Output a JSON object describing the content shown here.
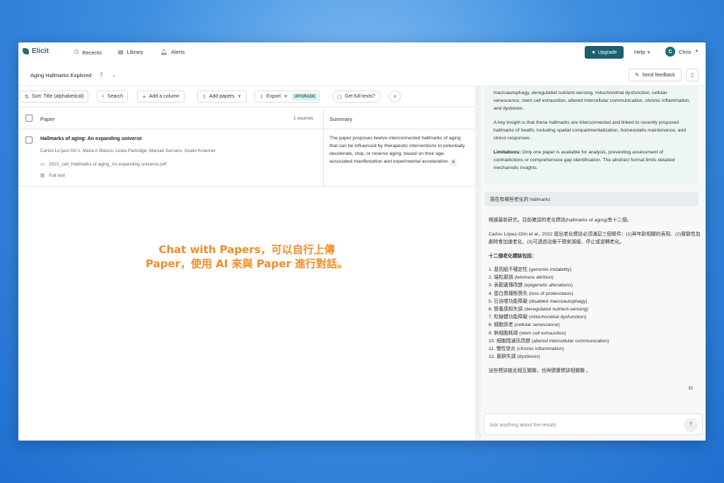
{
  "app": {
    "logo": "Elicit",
    "nav": [
      {
        "label": "Recents",
        "icon": "clock-icon"
      },
      {
        "label": "Library",
        "icon": "library-icon"
      },
      {
        "label": "Alerts",
        "icon": "bell-icon"
      }
    ],
    "upgrade_label": "Upgrade",
    "help_label": "Help",
    "user": {
      "initial": "C",
      "name": "Chris"
    }
  },
  "titlebar": {
    "title": "Aging Hallmarks Explored",
    "feedback_label": "Send feedback"
  },
  "toolbar": {
    "sort_label": "Sort: Title (alphabetical)",
    "search_label": "Search",
    "add_column_label": "Add a column",
    "add_papers_label": "Add papers",
    "export_label": "Export",
    "upgrade_tag": "UPGRADE",
    "fulltexts_label": "Get full-texts?"
  },
  "table": {
    "col_paper": "Paper",
    "sources": "1 sources",
    "col_summary": "Summary",
    "row": {
      "title": "Hallmarks of aging: An expanding universe",
      "authors": "Carlos Lo ́pez-Oti ́n, Maria A Blasco, Linda Partridge, Manuel Serrano, Guido Kroemer",
      "file": "2022_cell_Hallmarks of aging_An expanding universe.pdf",
      "full_text": "Full text",
      "summary": "The paper proposes twelve interconnected hallmarks of aging that can be influenced by therapeutic interventions to potentially decelerate, stop, or reverse aging, based on their age-associated manifestation and experimental acceleration."
    }
  },
  "overlay": {
    "line1": "Chat with Papers，可以自行上傳",
    "line2": "Paper，使用 AI 來與 Paper 進行對話。"
  },
  "chat": {
    "prev_answer": {
      "p1": "macroautophagy, deregulated nutrient-sensing, mitochondrial dysfunction, cellular senescence, stem cell exhaustion, altered intercellular communication, chronic inflammation, and dysbiosis .",
      "p2": "A key insight is that these hallmarks are interconnected and linked to recently proposed hallmarks of health, including spatial compartmentalization, homeostatis maintenance, and stress responses .",
      "limitations_label": "Limitations:",
      "limitations_text": " Only one paper is available for analysis, preventing assessment of contradictions or comprehensive gap identification. The abstract format limits detailed mechanistic insights."
    },
    "question": "現在有哪些老化的 hallmarks",
    "answer": {
      "intro": "根據最新研究，目前確認的老化標誌(hallmarks of aging)有十二個。",
      "p2": "Carlos López-Otín et al., 2022 提出老化標誌必須滿足三個條件：(1)與年齡相關的表現、(2)實驗性加劇時會加速老化、(3)可透過治療干預來減緩、停止或逆轉老化。",
      "heading": "十二個老化標誌包括：",
      "items": [
        "1. 基因組不穩定性 (genomic instability)",
        "2. 端粒磨損 (telomere attrition)",
        "3. 表觀遺傳改變 (epigenetic alterations)",
        "4. 蛋白質穩態喪失 (loss of proteostasis)",
        "5. 巨自噬功能障礙 (disabled macroautophagy)",
        "6. 營養感知失調 (deregulated nutrient-sensing)",
        "7. 粒線體功能障礙 (mitochondrial dysfunction)",
        "8. 細胞衰老 (cellular senescence)",
        "9. 幹細胞耗竭 (stem cell exhaustion)",
        "10. 細胞間通訊改變 (altered intercellular communication)",
        "11. 慢性發炎 (chronic inflammation)",
        "12. 菌群失調 (dysbiosis)"
      ],
      "closing": "這些標誌彼此相互關聯，也與健康標誌相關聯 。"
    },
    "input_placeholder": "Ask anything about the results"
  }
}
